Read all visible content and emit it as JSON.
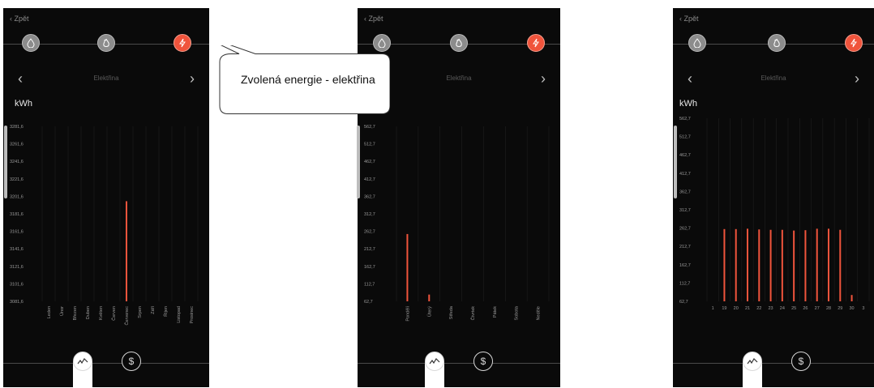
{
  "back_label": "Zpět",
  "nav_title": "Elektřina",
  "unit": "kWh",
  "callout": "Zvolená energie - elektřina",
  "icons": {
    "water": "water-drop-icon",
    "gas": "flame-icon",
    "electricity": "lightning-icon",
    "chart_tab": "chart-line-icon",
    "cost_tab": "dollar-icon"
  },
  "colors": {
    "accent": "#f0543c",
    "background": "#0a0a0a",
    "inactive": "#8c8c8c"
  },
  "tabs": {
    "cost_symbol": "$"
  },
  "screens": [
    {
      "period": "year",
      "y_ticks": [
        "3281,6",
        "3261,6",
        "3241,6",
        "3221,6",
        "3201,6",
        "3181,6",
        "3161,6",
        "3141,6",
        "3121,6",
        "3101,6",
        "3081,6"
      ],
      "ylim": [
        3081.6,
        3281.6
      ],
      "x_labels": [
        "Leden",
        "Únor",
        "Březen",
        "Duben",
        "Květen",
        "Červen",
        "Červenec",
        "Srpen",
        "Září",
        "Říjen",
        "Listopad",
        "Prosinec"
      ],
      "values": [
        null,
        null,
        null,
        null,
        null,
        null,
        3196,
        null,
        null,
        null,
        null,
        null
      ]
    },
    {
      "period": "week",
      "y_ticks": [
        "562,7",
        "512,7",
        "462,7",
        "412,7",
        "362,7",
        "312,7",
        "262,7",
        "212,7",
        "162,7",
        "112,7",
        "62,7"
      ],
      "ylim": [
        62.7,
        562.7
      ],
      "x_labels": [
        "Pondělí",
        "Úterý",
        "Středa",
        "Čtvrtek",
        "Pátek",
        "Sobota",
        "Neděle"
      ],
      "values": [
        255,
        82,
        null,
        null,
        null,
        null,
        null
      ]
    },
    {
      "period": "month",
      "y_ticks": [
        "562,7",
        "512,7",
        "462,7",
        "412,7",
        "362,7",
        "312,7",
        "262,7",
        "212,7",
        "162,7",
        "112,7",
        "62,7"
      ],
      "ylim": [
        62.7,
        562.7
      ],
      "x_labels": [
        "1",
        "19",
        "20",
        "21",
        "22",
        "23",
        "24",
        "25",
        "26",
        "27",
        "28",
        "29",
        "30",
        "3"
      ],
      "values": [
        null,
        260,
        260,
        261,
        259,
        258,
        258,
        256,
        257,
        261,
        261,
        258,
        80,
        null
      ]
    }
  ]
}
